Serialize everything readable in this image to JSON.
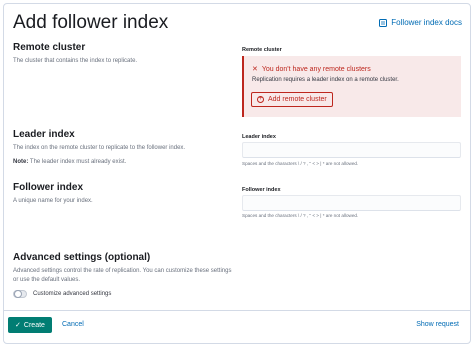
{
  "header": {
    "title": "Add follower index",
    "docs_link": "Follower index docs"
  },
  "remote_cluster": {
    "title": "Remote cluster",
    "description": "The cluster that contains the index to replicate.",
    "field_label": "Remote cluster",
    "callout_title": "You don't have any remote clusters",
    "callout_text": "Replication requires a leader index on a remote cluster.",
    "add_button": "Add remote cluster"
  },
  "leader_index": {
    "title": "Leader index",
    "description": "The index on the remote cluster to replicate to the follower index.",
    "note_label": "Note:",
    "note_text": "The leader index must already exist.",
    "field_label": "Leader index",
    "value": "",
    "help": "Spaces and the characters \\ / ? , \" < > | * are not allowed."
  },
  "follower_index": {
    "title": "Follower index",
    "description": "A unique name for your index.",
    "field_label": "Follower index",
    "value": "",
    "help": "Spaces and the characters \\ / ? , \" < > | * are not allowed."
  },
  "advanced": {
    "title": "Advanced settings (optional)",
    "description": "Advanced settings control the rate of replication. You can customize these settings or use the default values.",
    "toggle_label": "Customize advanced settings",
    "toggle_on": false
  },
  "footer": {
    "create": "Create",
    "cancel": "Cancel",
    "show_request": "Show request"
  },
  "colors": {
    "primary": "#017d73",
    "link": "#006bb4",
    "danger": "#bd271e",
    "danger_bg": "#f8e9e9"
  }
}
